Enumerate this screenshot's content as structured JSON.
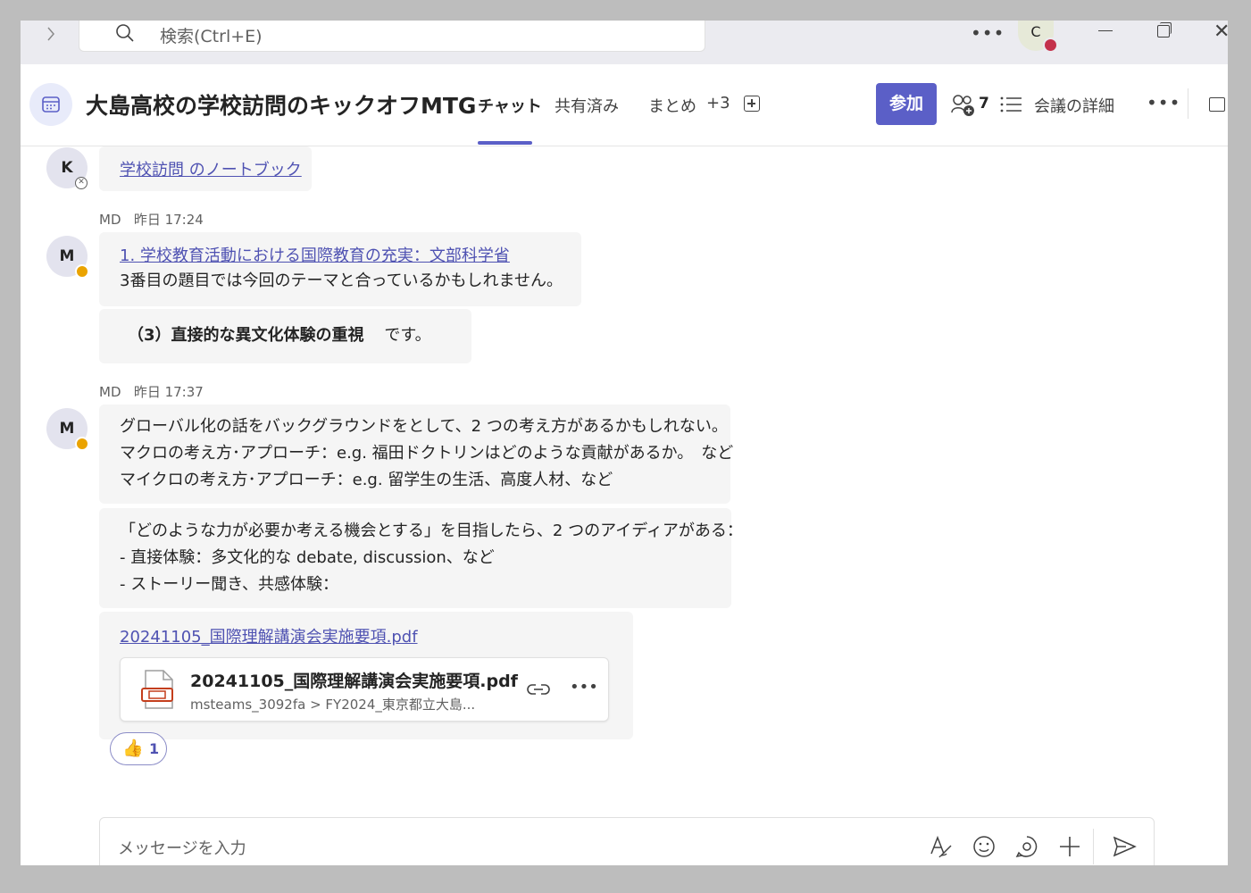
{
  "search": {
    "placeholder": "検索(Ctrl+E)"
  },
  "user": {
    "initial": "C"
  },
  "header": {
    "title": "大島高校の学校訪問のキックオフMTG",
    "tabs": [
      {
        "label": "チャット",
        "active": true
      },
      {
        "label": "共有済み"
      },
      {
        "label": "まとめ"
      },
      {
        "label": "+3"
      }
    ],
    "join_label": "参加",
    "participants_count": "7",
    "details_label": "会議の詳細"
  },
  "messages": {
    "m0": {
      "avatar": "K",
      "link": "学校訪問 のノートブック"
    },
    "m1": {
      "author": "MD",
      "time": "昨日 17:24",
      "avatar": "M",
      "link": "1. 学校教育活動における国際教育の充実：文部科学省",
      "text": "3番目の題目では今回のテーマと合っているかもしれません。",
      "bold_prefix": "（3）直接的な異文化体験の重視",
      "bold_suffix": "です。"
    },
    "m2": {
      "author": "MD",
      "time": "昨日 17:37",
      "avatar": "M",
      "lines_a": [
        "グローバル化の話をバックグラウンドをとして、2 つの考え方があるかもしれない。",
        "マクロの考え方･アプローチ：e.g. 福田ドクトリンはどのような貢献があるか。　など",
        "マイクロの考え方･アプローチ：e.g. 留学生の生活、高度人材、など"
      ],
      "lines_b": [
        "「どのような力が必要か考える機会とする」を目指したら、2 つのアイディアがある：",
        "- 直接体験：多文化的な debate, discussion、など",
        "- ストーリー聞き、共感体験："
      ],
      "file_link": "20241105_国際理解講演会実施要項.pdf",
      "file": {
        "name": "20241105_国際理解講演会実施要項.pdf",
        "path": "msteams_3092fa > FY2024_東京都立大島..."
      },
      "reaction": {
        "emoji": "👍",
        "count": "1"
      }
    }
  },
  "composer": {
    "placeholder": "メッセージを入力"
  },
  "colors": {
    "accent": "#5b5fc7",
    "link": "#4f52b2",
    "away": "#eaa300",
    "busy": "#c4314b"
  }
}
